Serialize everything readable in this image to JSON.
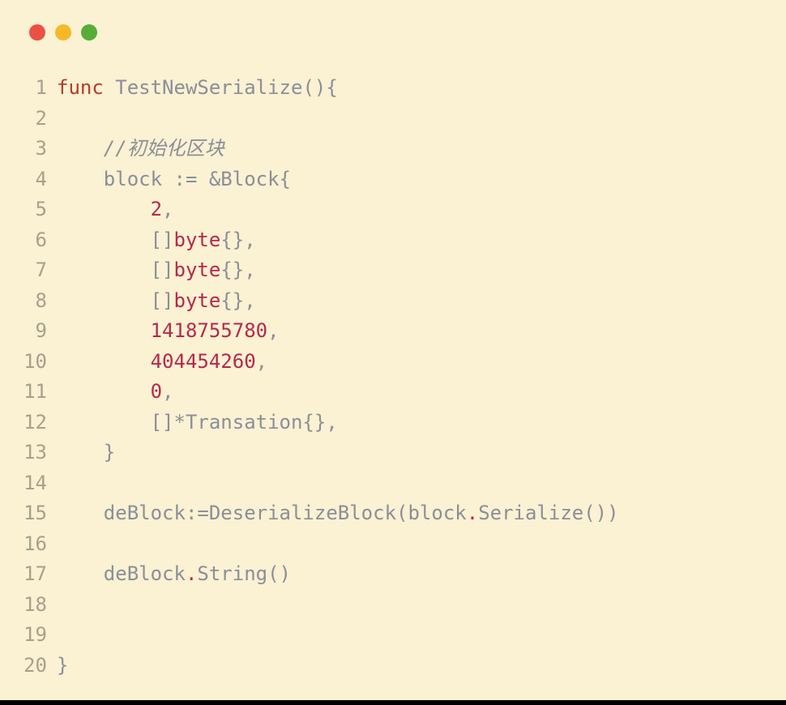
{
  "window": {
    "dots": [
      "red",
      "yellow",
      "green"
    ]
  },
  "code": {
    "lines": [
      {
        "n": 1,
        "tokens": [
          {
            "c": "kw",
            "t": "func"
          },
          {
            "c": "plain",
            "t": " "
          },
          {
            "c": "fn",
            "t": "TestNewSerialize"
          },
          {
            "c": "plain",
            "t": "(){"
          }
        ]
      },
      {
        "n": 2,
        "tokens": []
      },
      {
        "n": 3,
        "tokens": [
          {
            "c": "plain",
            "t": "    "
          },
          {
            "c": "comment",
            "t": "//初始化区块"
          }
        ]
      },
      {
        "n": 4,
        "tokens": [
          {
            "c": "plain",
            "t": "    block := &Block{"
          }
        ]
      },
      {
        "n": 5,
        "tokens": [
          {
            "c": "plain",
            "t": "        "
          },
          {
            "c": "num",
            "t": "2"
          },
          {
            "c": "plain",
            "t": ","
          }
        ]
      },
      {
        "n": 6,
        "tokens": [
          {
            "c": "plain",
            "t": "        []"
          },
          {
            "c": "typ",
            "t": "byte"
          },
          {
            "c": "plain",
            "t": "{},"
          }
        ]
      },
      {
        "n": 7,
        "tokens": [
          {
            "c": "plain",
            "t": "        []"
          },
          {
            "c": "typ",
            "t": "byte"
          },
          {
            "c": "plain",
            "t": "{},"
          }
        ]
      },
      {
        "n": 8,
        "tokens": [
          {
            "c": "plain",
            "t": "        []"
          },
          {
            "c": "typ",
            "t": "byte"
          },
          {
            "c": "plain",
            "t": "{},"
          }
        ]
      },
      {
        "n": 9,
        "tokens": [
          {
            "c": "plain",
            "t": "        "
          },
          {
            "c": "num",
            "t": "1418755780"
          },
          {
            "c": "plain",
            "t": ","
          }
        ]
      },
      {
        "n": 10,
        "tokens": [
          {
            "c": "plain",
            "t": "        "
          },
          {
            "c": "num",
            "t": "404454260"
          },
          {
            "c": "plain",
            "t": ","
          }
        ]
      },
      {
        "n": 11,
        "tokens": [
          {
            "c": "plain",
            "t": "        "
          },
          {
            "c": "num",
            "t": "0"
          },
          {
            "c": "plain",
            "t": ","
          }
        ]
      },
      {
        "n": 12,
        "tokens": [
          {
            "c": "plain",
            "t": "        []*Transation{},"
          }
        ]
      },
      {
        "n": 13,
        "tokens": [
          {
            "c": "plain",
            "t": "    }"
          }
        ]
      },
      {
        "n": 14,
        "tokens": []
      },
      {
        "n": 15,
        "tokens": [
          {
            "c": "plain",
            "t": "    deBlock:=DeserializeBlock(block"
          },
          {
            "c": "dot-op",
            "t": "."
          },
          {
            "c": "plain",
            "t": "Serialize())"
          }
        ]
      },
      {
        "n": 16,
        "tokens": []
      },
      {
        "n": 17,
        "tokens": [
          {
            "c": "plain",
            "t": "    deBlock"
          },
          {
            "c": "dot-op",
            "t": "."
          },
          {
            "c": "plain",
            "t": "String()"
          }
        ]
      },
      {
        "n": 18,
        "tokens": []
      },
      {
        "n": 19,
        "tokens": []
      },
      {
        "n": 20,
        "tokens": [
          {
            "c": "plain",
            "t": "}"
          }
        ]
      }
    ]
  }
}
